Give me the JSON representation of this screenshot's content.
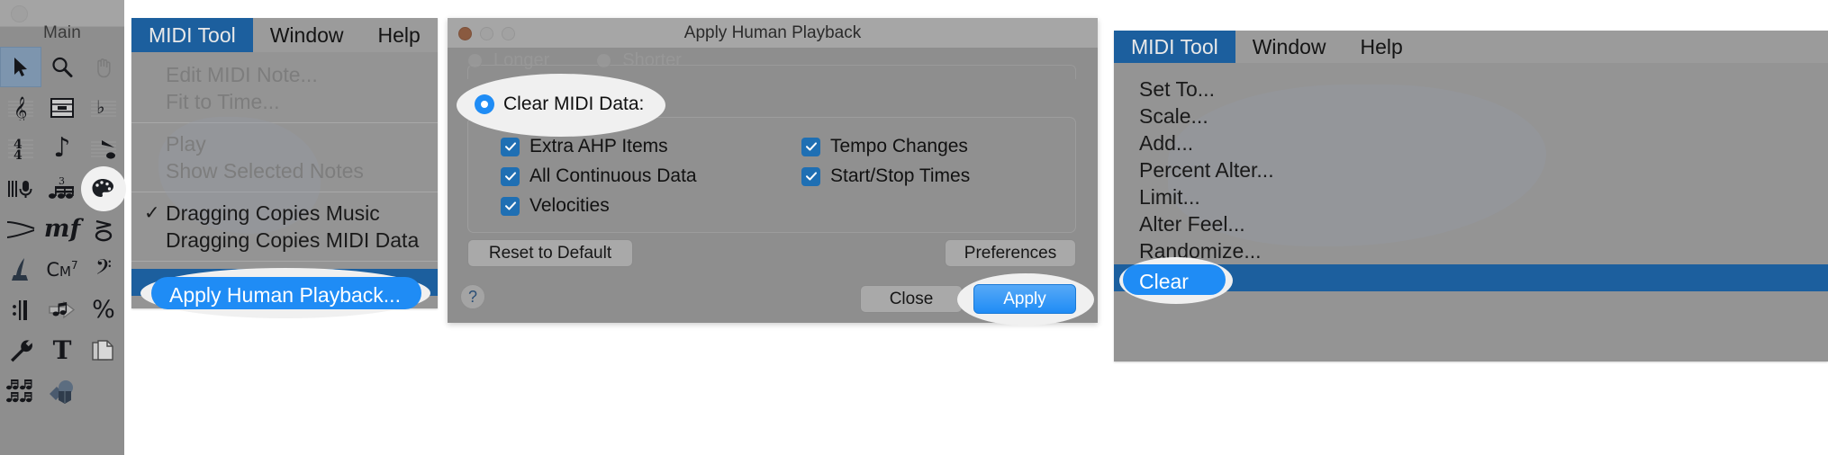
{
  "palette": {
    "title": "Main",
    "tools": [
      {
        "name": "arrow-select-tool",
        "icon": "arrow",
        "selected": true
      },
      {
        "name": "zoom-tool",
        "icon": "magnifier",
        "selected": false
      },
      {
        "name": "hand-tool",
        "icon": "hand",
        "selected": false
      },
      {
        "name": "clef-tool",
        "icon": "treble-clef",
        "selected": false
      },
      {
        "name": "measure-tool",
        "icon": "measure",
        "selected": false
      },
      {
        "name": "key-signature-tool",
        "icon": "key-signature",
        "selected": false
      },
      {
        "name": "time-signature-tool",
        "icon": "time-signature",
        "selected": false
      },
      {
        "name": "simple-entry-tool",
        "icon": "eighth-note",
        "selected": false
      },
      {
        "name": "speedy-entry-tool",
        "icon": "speedy-note",
        "selected": false
      },
      {
        "name": "lyrics-tool",
        "icon": "microphone",
        "selected": false
      },
      {
        "name": "tuplet-tool",
        "icon": "triplet",
        "selected": false
      },
      {
        "name": "midi-tool",
        "icon": "midi-palette",
        "selected": false,
        "highlighted": true
      },
      {
        "name": "smart-shape-tool",
        "icon": "hairpin",
        "selected": false
      },
      {
        "name": "expression-tool",
        "icon": "mezzo-forte",
        "selected": false
      },
      {
        "name": "articulation-tool",
        "icon": "articulation",
        "selected": false
      },
      {
        "name": "note-mover-tool",
        "icon": "quill",
        "selected": false
      },
      {
        "name": "chord-tool",
        "icon": "chord-cm7",
        "selected": false
      },
      {
        "name": "bass-clef-tool",
        "icon": "bass-clef",
        "selected": false
      },
      {
        "name": "repeat-tool",
        "icon": "repeat-barline",
        "selected": false
      },
      {
        "name": "note-shape-tool",
        "icon": "note-arrow",
        "selected": false
      },
      {
        "name": "percent-repeat-tool",
        "icon": "percent",
        "selected": false
      },
      {
        "name": "utilities-tool",
        "icon": "wrench",
        "selected": false
      },
      {
        "name": "text-tool",
        "icon": "letter-t",
        "selected": false
      },
      {
        "name": "page-layout-tool",
        "icon": "pages",
        "selected": false
      },
      {
        "name": "beam-tool",
        "icon": "beams",
        "selected": false
      },
      {
        "name": "special-tools",
        "icon": "shapes",
        "selected": false
      }
    ]
  },
  "left_menu": {
    "menubar": [
      {
        "label": "MIDI Tool",
        "active": true
      },
      {
        "label": "Window",
        "active": false
      },
      {
        "label": "Help",
        "active": false
      }
    ],
    "items": [
      {
        "label": "Edit MIDI Note...",
        "disabled": true,
        "checked": false
      },
      {
        "label": "Fit to Time...",
        "disabled": true,
        "checked": false
      },
      {
        "separator": true
      },
      {
        "label": "Play",
        "disabled": true,
        "checked": false
      },
      {
        "label": "Show Selected Notes",
        "disabled": true,
        "checked": false
      },
      {
        "separator": true
      },
      {
        "label": "Dragging Copies Music",
        "disabled": false,
        "checked": true
      },
      {
        "label": "Dragging Copies MIDI Data",
        "disabled": false,
        "checked": false
      },
      {
        "separator": true
      },
      {
        "label": "Apply Human Playback...",
        "disabled": false,
        "checked": false,
        "highlight": true
      }
    ],
    "check_glyph": "✓"
  },
  "dialog": {
    "title": "Apply Human Playback",
    "ghost_row": {
      "option_longer": "Longer",
      "option_shorter": "Shorter"
    },
    "radio": {
      "label": "Clear MIDI Data:",
      "selected": true
    },
    "checkboxes_left": [
      {
        "label": "Extra AHP Items",
        "checked": true
      },
      {
        "label": "All Continuous Data",
        "checked": true
      },
      {
        "label": "Velocities",
        "checked": true
      }
    ],
    "checkboxes_right": [
      {
        "label": "Tempo Changes",
        "checked": true
      },
      {
        "label": "Start/Stop Times",
        "checked": true
      }
    ],
    "buttons": {
      "reset": "Reset to Default",
      "preferences": "Preferences",
      "close": "Close",
      "apply": "Apply",
      "help": "?"
    }
  },
  "right_menu": {
    "menubar": [
      {
        "label": "MIDI Tool",
        "active": true
      },
      {
        "label": "Window",
        "active": false
      },
      {
        "label": "Help",
        "active": false
      }
    ],
    "items": [
      {
        "label": "Set To...",
        "highlight": false
      },
      {
        "label": "Scale...",
        "highlight": false
      },
      {
        "label": "Add...",
        "highlight": false
      },
      {
        "label": "Percent Alter...",
        "highlight": false
      },
      {
        "label": "Limit...",
        "highlight": false
      },
      {
        "label": "Alter Feel...",
        "highlight": false
      },
      {
        "label": "Randomize...",
        "highlight": false
      },
      {
        "label": "Clear",
        "highlight": true
      }
    ]
  },
  "colors": {
    "menu_highlight_blue": "#1c5f9e",
    "callout_blue": "#1f8cf5",
    "callout_white": "#f0f0f0",
    "checkbox_blue": "#1f6fb3",
    "panel_gray": "#949494",
    "palette_gray": "#8e8e8e"
  }
}
